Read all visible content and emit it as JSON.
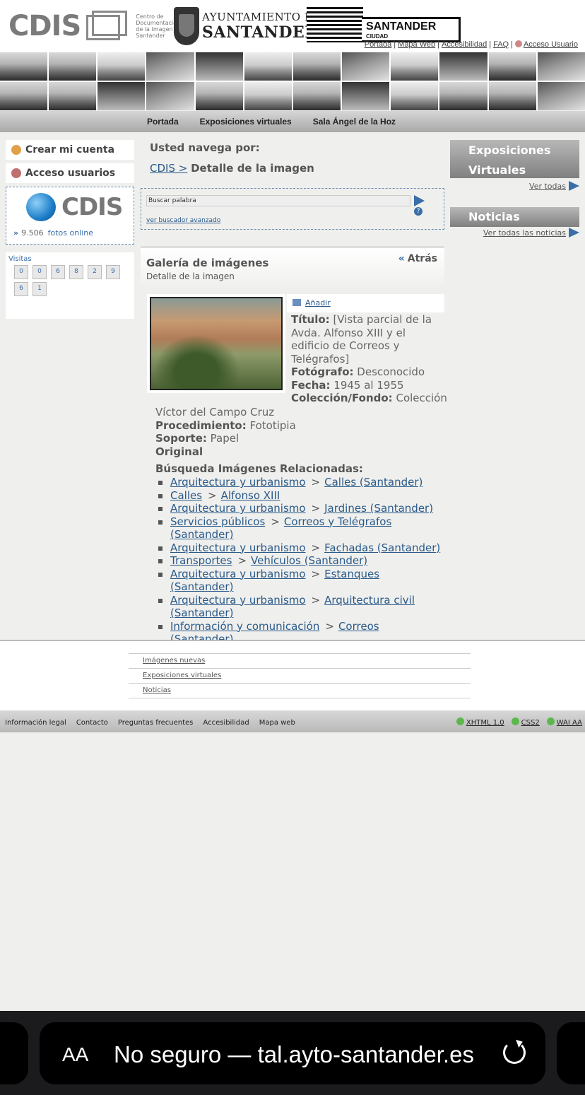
{
  "header": {
    "cdis_logo": "CDIS",
    "cdis_subtitle": "Centro de Documentación de la Imagen de Santander",
    "ayto_line1": "AYUNTAMIENTO DE",
    "ayto_line2": "SANTANDER",
    "santander_brand": "SANTANDER",
    "santander_sub": "CIUDAD",
    "top_links": [
      "Portada",
      "Mapa Web",
      "Accesibilidad",
      "FAQ",
      "Acceso Usuario"
    ]
  },
  "nav": [
    "Portada",
    "Exposiciones virtuales",
    "Sala Ángel de la Hoz"
  ],
  "left": {
    "create_account": "Crear mi cuenta",
    "user_access": "Acceso usuarios",
    "cdis_big": "CDIS",
    "photo_count": "9.506",
    "photos_online": "fotos online",
    "visits_title": "Visitas",
    "visit_digits": [
      "0",
      "0",
      "6",
      "8",
      "2",
      "9",
      "6",
      "1"
    ]
  },
  "center": {
    "navigating_label": "Usted navega por:",
    "crumb_home": "CDIS >",
    "crumb_current": "Detalle de la imagen",
    "search_placeholder": "Buscar palabra",
    "help": "?",
    "advanced_search": "ver buscador avanzado",
    "gallery_title": "Galería de imágenes",
    "gallery_subtitle": "Detalle de la imagen",
    "back": "Atrás",
    "back_icon": "«",
    "add": "Añadir"
  },
  "meta": {
    "title_label": "Título:",
    "title_value": "[Vista parcial de la Avda. Alfonso XIII y el edificio de Correos y Telégrafos]",
    "photographer_label": "Fotógrafo:",
    "photographer_value": "Desconocido",
    "date_label": "Fecha:",
    "date_value": "1945 al 1955",
    "collection_label": "Colección/Fondo:",
    "collection_value_a": "Colección",
    "collection_value_b": "Víctor del Campo Cruz",
    "procedure_label": "Procedimiento:",
    "procedure_value": "Fototipia",
    "support_label": "Soporte:",
    "support_value": "Papel",
    "original": "Original"
  },
  "related": {
    "title": "Búsqueda Imágenes Relacionadas:",
    "items": [
      {
        "a": "Arquitectura y urbanismo",
        "b": "Calles (Santander)"
      },
      {
        "a": "Calles",
        "b": "Alfonso XIII"
      },
      {
        "a": "Arquitectura y urbanismo",
        "b": "Jardines (Santander)"
      },
      {
        "a": "Servicios públicos",
        "b": "Correos y Telégrafos (Santander)"
      },
      {
        "a": "Arquitectura y urbanismo",
        "b": "Fachadas (Santander)"
      },
      {
        "a": "Transportes",
        "b": "Vehículos (Santander)"
      },
      {
        "a": "Arquitectura y urbanismo",
        "b": "Estanques (Santander)"
      },
      {
        "a": "Arquitectura y urbanismo",
        "b": "Arquitectura civil (Santander)"
      },
      {
        "a": "Información y comunicación",
        "b": "Correos (Santander)"
      }
    ]
  },
  "right": {
    "expo_line1": "Exposiciones",
    "expo_line2": "Virtuales",
    "see_all": "Ver todas",
    "news_title": "Noticias",
    "see_all_news": "Ver todas las noticias"
  },
  "footer": {
    "links": [
      "Imágenes nuevas",
      "Exposiciones virtuales",
      "Noticias"
    ],
    "bar_left": [
      "Información legal",
      "Contacto",
      "Preguntas frecuentes",
      "Accesibilidad",
      "Mapa web"
    ],
    "bar_right": [
      "XHTML 1.0",
      "CSS2",
      "WAI AA"
    ]
  },
  "browser": {
    "aa_label": "AA",
    "url_text": "No seguro — tal.ayto-santander.es"
  },
  "colors": {
    "link": "#2a5a8a",
    "accent_blue": "#3a6ea8",
    "valid_green": "#5cb84c"
  }
}
